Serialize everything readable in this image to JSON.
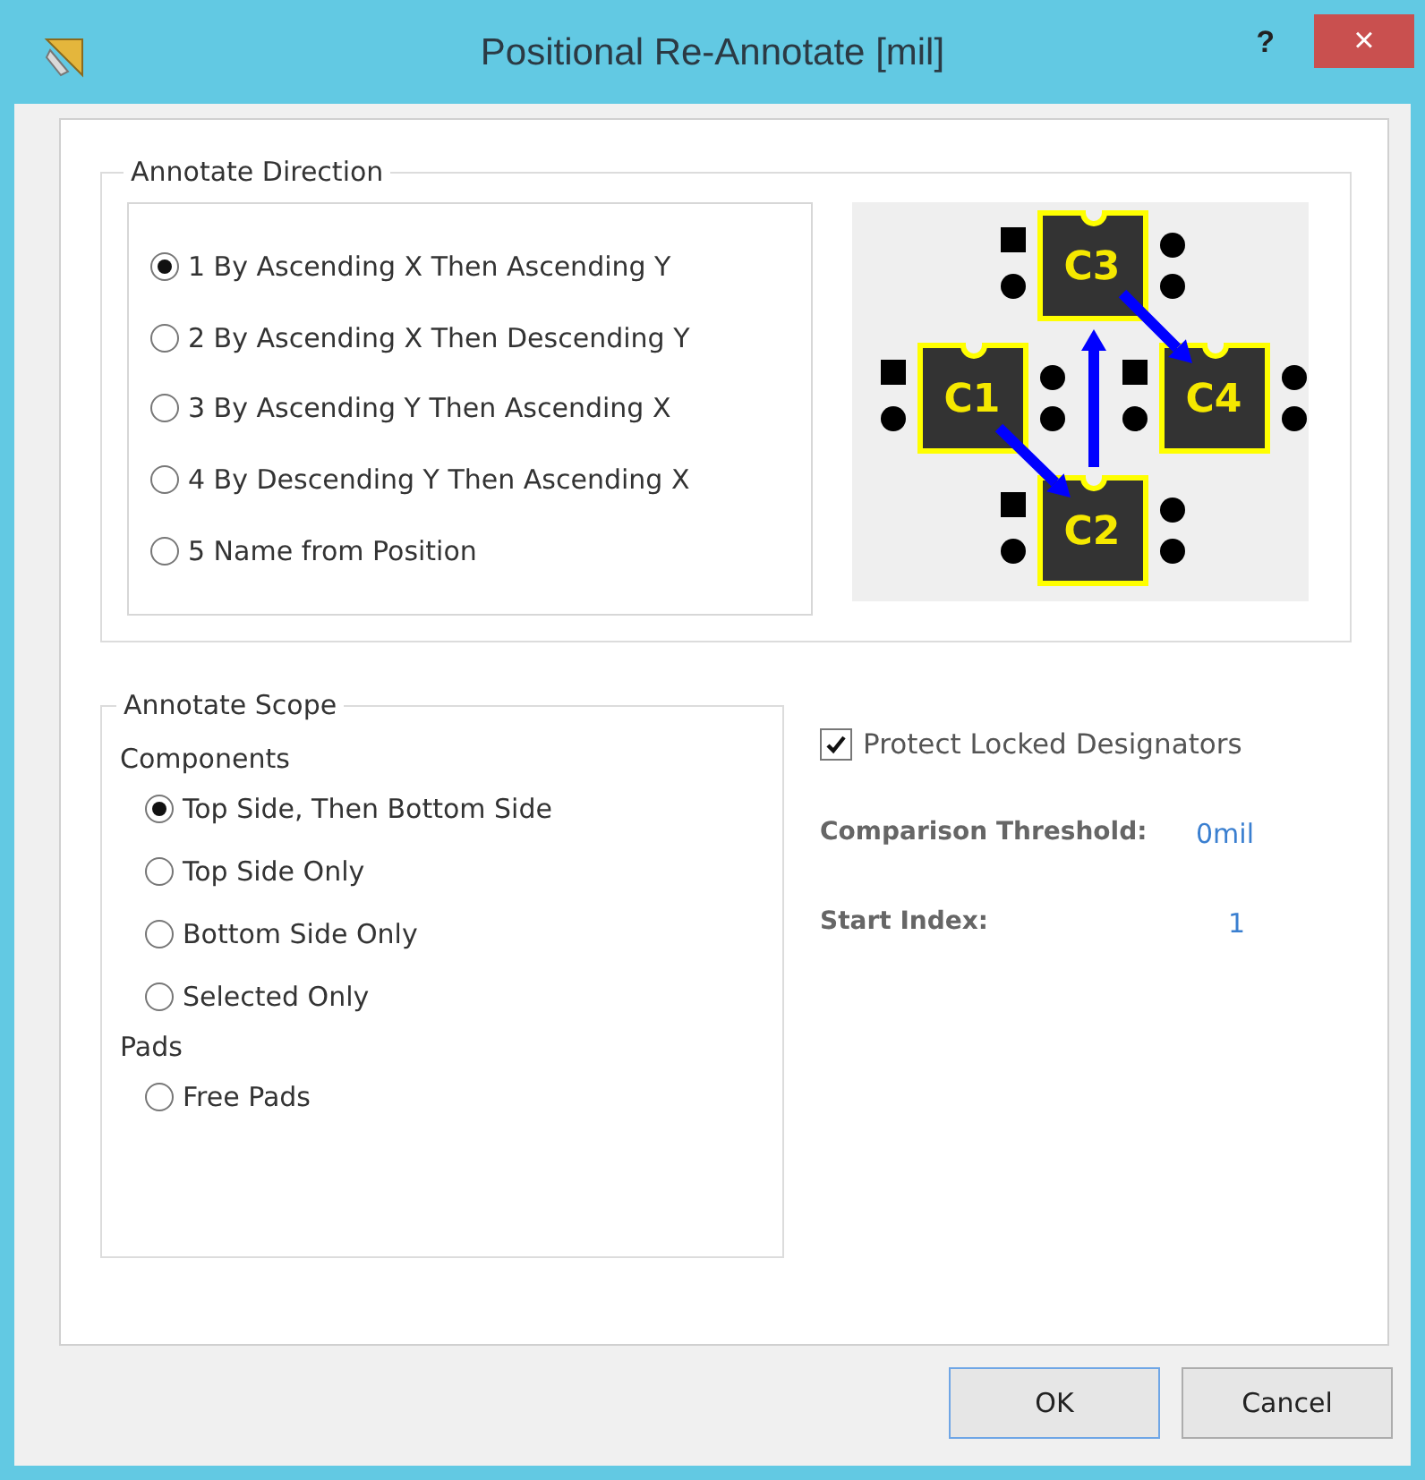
{
  "window": {
    "title": "Positional Re-Annotate [mil]",
    "help": "?",
    "close": "×"
  },
  "annotate_direction": {
    "title": "Annotate Direction",
    "options": [
      {
        "label": "1 By Ascending X Then Ascending Y",
        "selected": true
      },
      {
        "label": "2 By Ascending X Then Descending Y",
        "selected": false
      },
      {
        "label": "3 By Ascending Y Then Ascending X",
        "selected": false
      },
      {
        "label": "4 By Descending Y Then Ascending X",
        "selected": false
      },
      {
        "label": "5 Name from Position",
        "selected": false
      }
    ],
    "diagram": {
      "components": [
        {
          "label": "C3"
        },
        {
          "label": "C1"
        },
        {
          "label": "C4"
        },
        {
          "label": "C2"
        }
      ]
    }
  },
  "annotate_scope": {
    "title": "Annotate Scope",
    "sections": [
      {
        "heading": "Components",
        "options": [
          {
            "label": "Top Side, Then Bottom Side",
            "selected": true
          },
          {
            "label": "Top Side Only",
            "selected": false
          },
          {
            "label": "Bottom Side Only",
            "selected": false
          },
          {
            "label": "Selected Only",
            "selected": false
          }
        ]
      },
      {
        "heading": "Pads",
        "options": [
          {
            "label": "Free Pads",
            "selected": false
          }
        ]
      }
    ]
  },
  "protect_locked": {
    "label": "Protect Locked Designators",
    "checked": true
  },
  "fields": [
    {
      "label": "Comparison Threshold:",
      "value": "0mil"
    },
    {
      "label": "Start Index:",
      "value": "1"
    }
  ],
  "buttons": [
    {
      "label": "OK",
      "kind": "default"
    },
    {
      "label": "Cancel",
      "kind": "normal"
    }
  ]
}
